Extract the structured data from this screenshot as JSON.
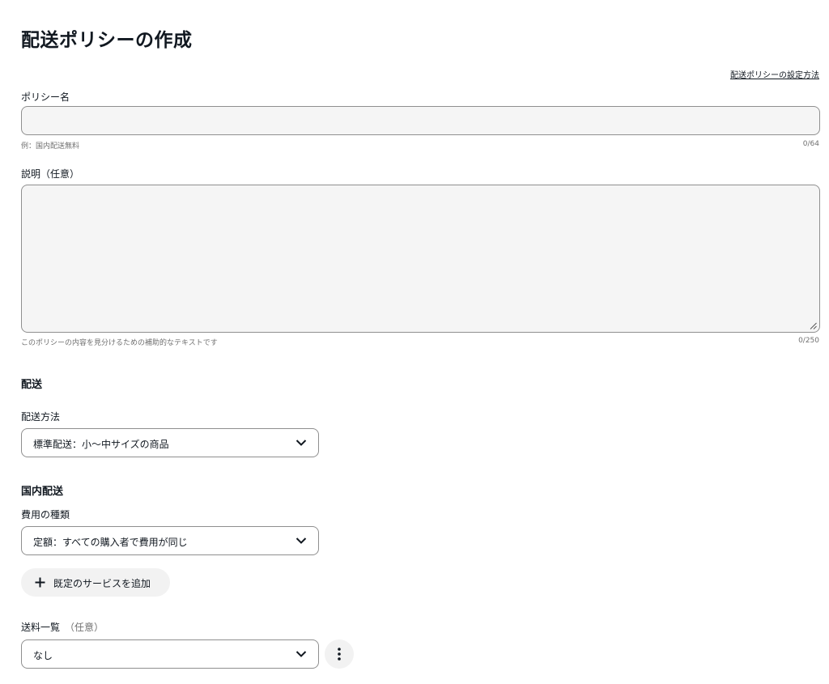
{
  "page": {
    "title": "配送ポリシーの作成",
    "help_link": "配送ポリシーの設定方法"
  },
  "policy_name": {
    "label": "ポリシー名",
    "value": "",
    "hint": "例：国内配送無料",
    "counter": "0/64"
  },
  "description": {
    "label": "説明（任意）",
    "value": "",
    "hint": "このポリシーの内容を見分けるための補助的なテキストです",
    "counter": "0/250"
  },
  "shipping": {
    "heading": "配送",
    "method_label": "配送方法",
    "method_value": "標準配送：小〜中サイズの商品"
  },
  "domestic": {
    "heading": "国内配送",
    "cost_type_label": "費用の種類",
    "cost_type_value": "定額：すべての購入者で費用が同じ",
    "add_service_label": "既定のサービスを追加",
    "rate_table_label": "送料一覧",
    "rate_table_optional": "（任意）",
    "rate_table_value": "なし"
  },
  "icons": {
    "add": "plus-icon",
    "dropdown": "chevron-down-icon",
    "more": "more-vertical-icon",
    "resize": "resize-handle-icon"
  },
  "colors": {
    "text": "#111820",
    "muted": "#707070",
    "field_bg": "#f5f5f5",
    "border": "#8f8f8f"
  }
}
